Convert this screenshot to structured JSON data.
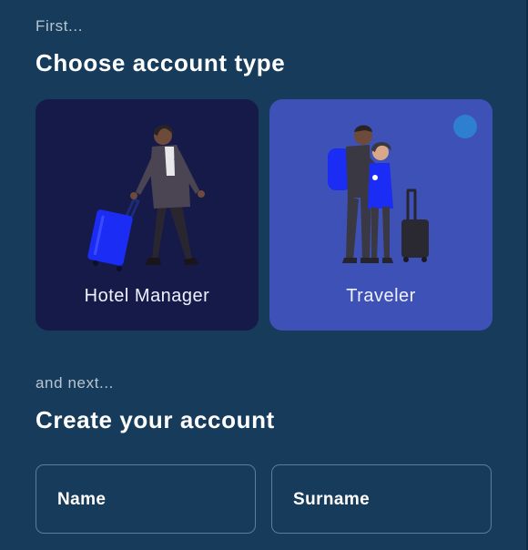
{
  "step1": {
    "kicker": "First...",
    "title": "Choose account type"
  },
  "account_types": [
    {
      "label": "Hotel Manager",
      "selected": false,
      "illustration": "woman-with-suitcase-illustration"
    },
    {
      "label": "Traveler",
      "selected": true,
      "illustration": "travelers-with-luggage-illustration"
    }
  ],
  "step2": {
    "kicker": "and next...",
    "title": "Create your account"
  },
  "form": {
    "name_label": "Name",
    "surname_label": "Surname"
  },
  "colors": {
    "background": "#173b5a",
    "hotel_card": "#161a48",
    "traveler_card_selected": "#3e51b6",
    "accent_blue": "#1436ff"
  }
}
